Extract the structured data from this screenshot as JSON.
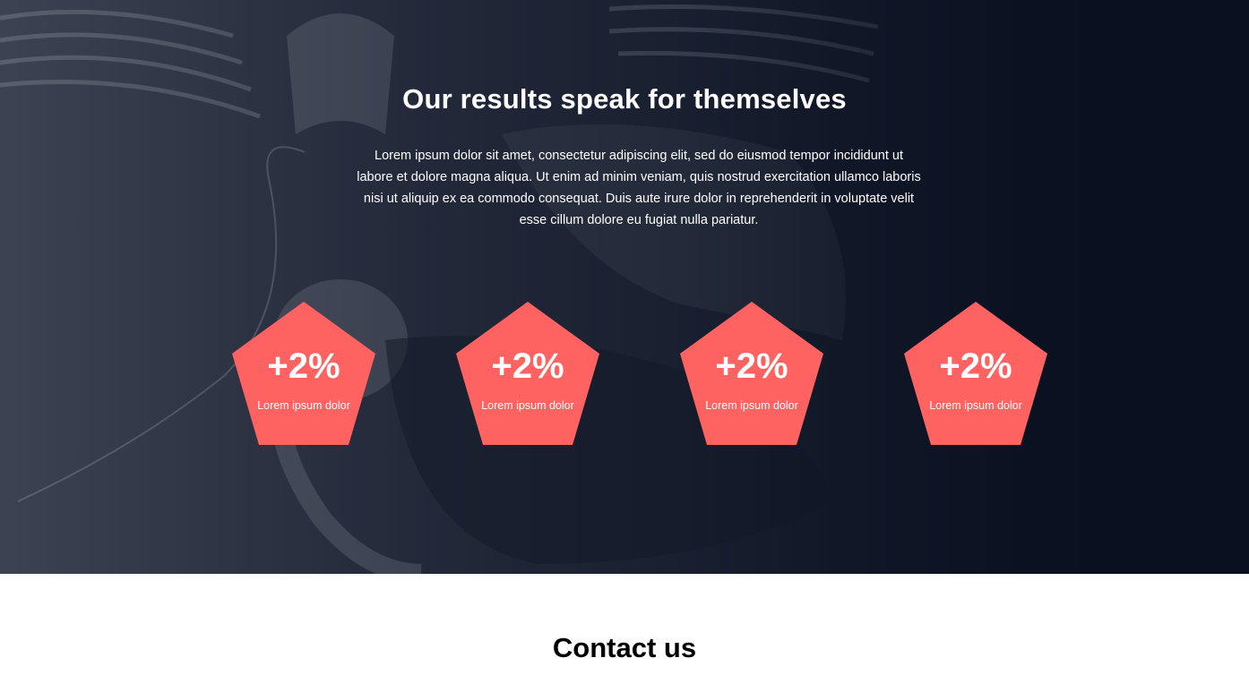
{
  "results": {
    "title": "Our results speak for themselves",
    "description": "Lorem ipsum dolor sit amet, consectetur adipiscing elit, sed do eiusmod tempor incididunt ut labore et dolore magna aliqua. Ut enim ad minim veniam, quis nostrud exercitation ullamco laboris nisi ut aliquip ex ea commodo consequat. Duis aute irure dolor in reprehenderit in voluptate velit esse cillum dolore eu fugiat nulla pariatur.",
    "stats": [
      {
        "value": "+2%",
        "label": "Lorem ipsum dolor"
      },
      {
        "value": "+2%",
        "label": "Lorem ipsum dolor"
      },
      {
        "value": "+2%",
        "label": "Lorem ipsum dolor"
      },
      {
        "value": "+2%",
        "label": "Lorem ipsum dolor"
      }
    ]
  },
  "contact": {
    "title": "Contact us"
  },
  "colors": {
    "accent": "#ff6361",
    "hero_dark": "#0c1424"
  }
}
